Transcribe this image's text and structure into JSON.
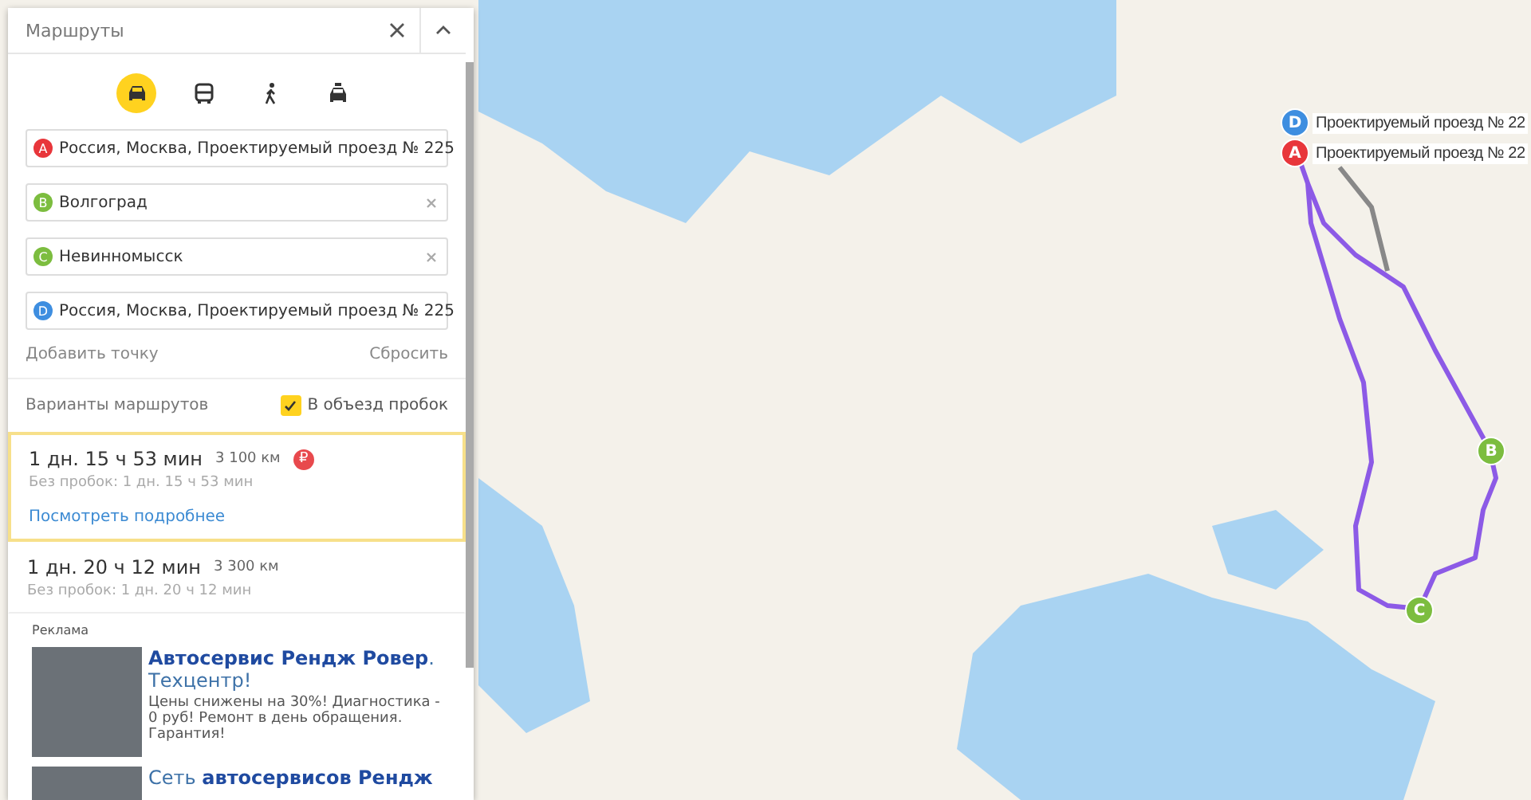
{
  "panel": {
    "title": "Маршруты",
    "modes": [
      {
        "kind": "car",
        "selected": true
      },
      {
        "kind": "bus",
        "selected": false
      },
      {
        "kind": "walk",
        "selected": false
      },
      {
        "kind": "taxi",
        "selected": false
      }
    ],
    "points": [
      {
        "letter": "A",
        "color": "#e8363b",
        "value": "Россия, Москва, Проектируемый проезд № 225"
      },
      {
        "letter": "B",
        "color": "#7cbd3f",
        "value": "Волгоград"
      },
      {
        "letter": "C",
        "color": "#7cbd3f",
        "value": "Невинномысск"
      },
      {
        "letter": "D",
        "color": "#3e8ee0",
        "value": "Россия, Москва, Проектируемый проезд № 225"
      }
    ],
    "add_point": "Добавить точку",
    "reset": "Сбросить",
    "variants_label": "Варианты маршрутов",
    "avoid_traffic": {
      "label": "В объезд пробок",
      "checked": true
    },
    "routes": [
      {
        "time": "1 дн. 15 ч 53 мин",
        "distance": "3 100 км",
        "badge": "₽",
        "no_traffic": "Без пробок: 1 дн. 15 ч 53 мин",
        "details": "Посмотреть подробнее",
        "selected": true
      },
      {
        "time": "1 дн. 20 ч 12 мин",
        "distance": "3 300 км",
        "no_traffic": "Без пробок: 1 дн. 20 ч 12 мин",
        "selected": false
      }
    ],
    "ads_label": "Реклама",
    "ads": [
      {
        "title": "**Автосервис Рендж Ровер**. Техцентр!",
        "text": "Цены снижены на 30%! Диагностика - 0 руб! Ремонт в день обращения. Гарантия!"
      },
      {
        "title": "Сеть **автосервисов Рендж**"
      }
    ]
  },
  "map": {
    "pins": [
      {
        "letter": "D",
        "color": "#3e8ee0",
        "label": "Проектируемый проезд № 22"
      },
      {
        "letter": "A",
        "color": "#e8363b",
        "label": "Проектируемый проезд № 22"
      },
      {
        "letter": "B",
        "color": "#7cbd3f"
      },
      {
        "letter": "C",
        "color": "#7cbd3f"
      }
    ]
  }
}
